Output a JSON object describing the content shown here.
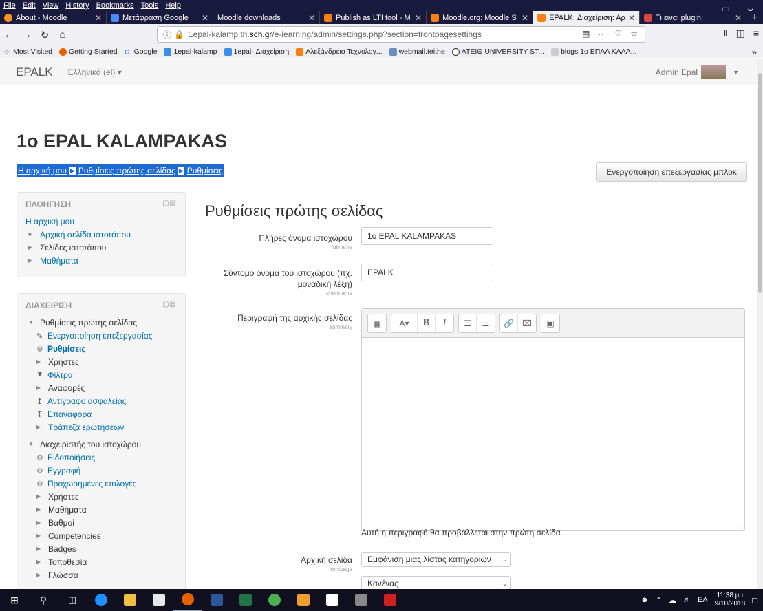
{
  "browser": {
    "menu": [
      "File",
      "Edit",
      "View",
      "History",
      "Bookmarks",
      "Tools",
      "Help"
    ],
    "tabs": [
      {
        "label": "About - Moodle",
        "color": "#f7931e"
      },
      {
        "label": "Μετάφραση Google",
        "color": "#4a8af4"
      },
      {
        "label": "Moodle downloads",
        "color": "#1a1a3e"
      },
      {
        "label": "Publish as LTI tool - M",
        "color": "#f98012"
      },
      {
        "label": "Moodle.org: Moodle S",
        "color": "#f98012"
      },
      {
        "label": "EPALK: Διαχείριση: Αρ",
        "color": "#f98012"
      },
      {
        "label": "Τι ειναι plugin;",
        "color": "#d44"
      }
    ],
    "url_prefix": "1epal-kalamp.tri.",
    "url_domain": "sch.gr",
    "url_path": "/e-learning/admin/settings.php?section=frontpagesettings",
    "bookmarks": [
      "Most Visited",
      "Getting Started",
      "Google",
      "1epal-kalamp",
      "1epal- Διαχείριση",
      "Αλεξάνδρειο Τεχνολογ...",
      "webmail.teithe",
      "ATEIΘ UNIVERSITY ST...",
      "blogs 1o ΕΠΑΛ ΚΑΛΑ..."
    ]
  },
  "moodle": {
    "brand": "EPALK",
    "lang": "Ελληνικά (el) ▾",
    "user": "Admin Epal",
    "site_title": "1o EPAL KALAMPAKAS",
    "breadcrumb": [
      "Η αρχική μου",
      "Ρυθμίσεις πρώτης σελίδας",
      "Ρυθμίσεις"
    ],
    "block_edit_button": "Ενεργοποίηση επεξεργασίας μπλοκ",
    "nav_block": {
      "title": "ΠΛΟΗΓΗΣΗ",
      "home": "Η αρχική μου",
      "items": [
        "Αρχική σελίδα ιστοτόπου",
        "Σελίδες ιστοτόπου",
        "Μαθήματα"
      ]
    },
    "admin_block": {
      "title": "ΔΙΑΧΕΙΡΙΣΗ",
      "frontpage": "Ρυθμίσεις πρώτης σελίδας",
      "frontpage_items": [
        "Ενεργοποίηση επεξεργασίας",
        "Ρυθμίσεις",
        "Χρήστες",
        "Φίλτρα",
        "Αναφορές",
        "Αντίγραφο ασφαλείας",
        "Επαναφορά",
        "Τράπεζα ερωτήσεων"
      ],
      "siteadmin": "Διαχειριστής του ιστοχώρου",
      "siteadmin_items": [
        "Ειδοποιήσεις",
        "Εγγραφή",
        "Προχωρημένες επιλογές",
        "Χρήστες",
        "Μαθήματα",
        "Βαθμοί",
        "Competencies",
        "Badges",
        "Τοποθεσία",
        "Γλώσσα"
      ]
    },
    "form": {
      "title": "Ρυθμίσεις πρώτης σελίδας",
      "fullname_label": "Πλήρες όνομα ιστοχώρου",
      "fullname_key": "fullname",
      "fullname_value": "1o EPAL KALAMPAKAS",
      "shortname_label1": "Σύντομο όνομα του ιστοχώρου (πχ.",
      "shortname_label2": "μοναδική λέξη)",
      "shortname_key": "shortname",
      "shortname_value": "EPALK",
      "summary_label": "Περιγραφή της αρχικής σελίδας",
      "summary_key": "summary",
      "summary_hint": "Αυτή η περιγραφή θα προβάλλεται στην πρώτη σελίδα.",
      "frontpage_label": "Αρχική σελίδα",
      "frontpage_key": "frontpage",
      "frontpage_value": "Εμφάνιση μιας λίστας κατηγοριών",
      "frontpage_value2": "Κανένας"
    }
  },
  "taskbar": {
    "lang": "ΕΛ",
    "time": "11:38 μμ",
    "date": "9/10/2018"
  }
}
